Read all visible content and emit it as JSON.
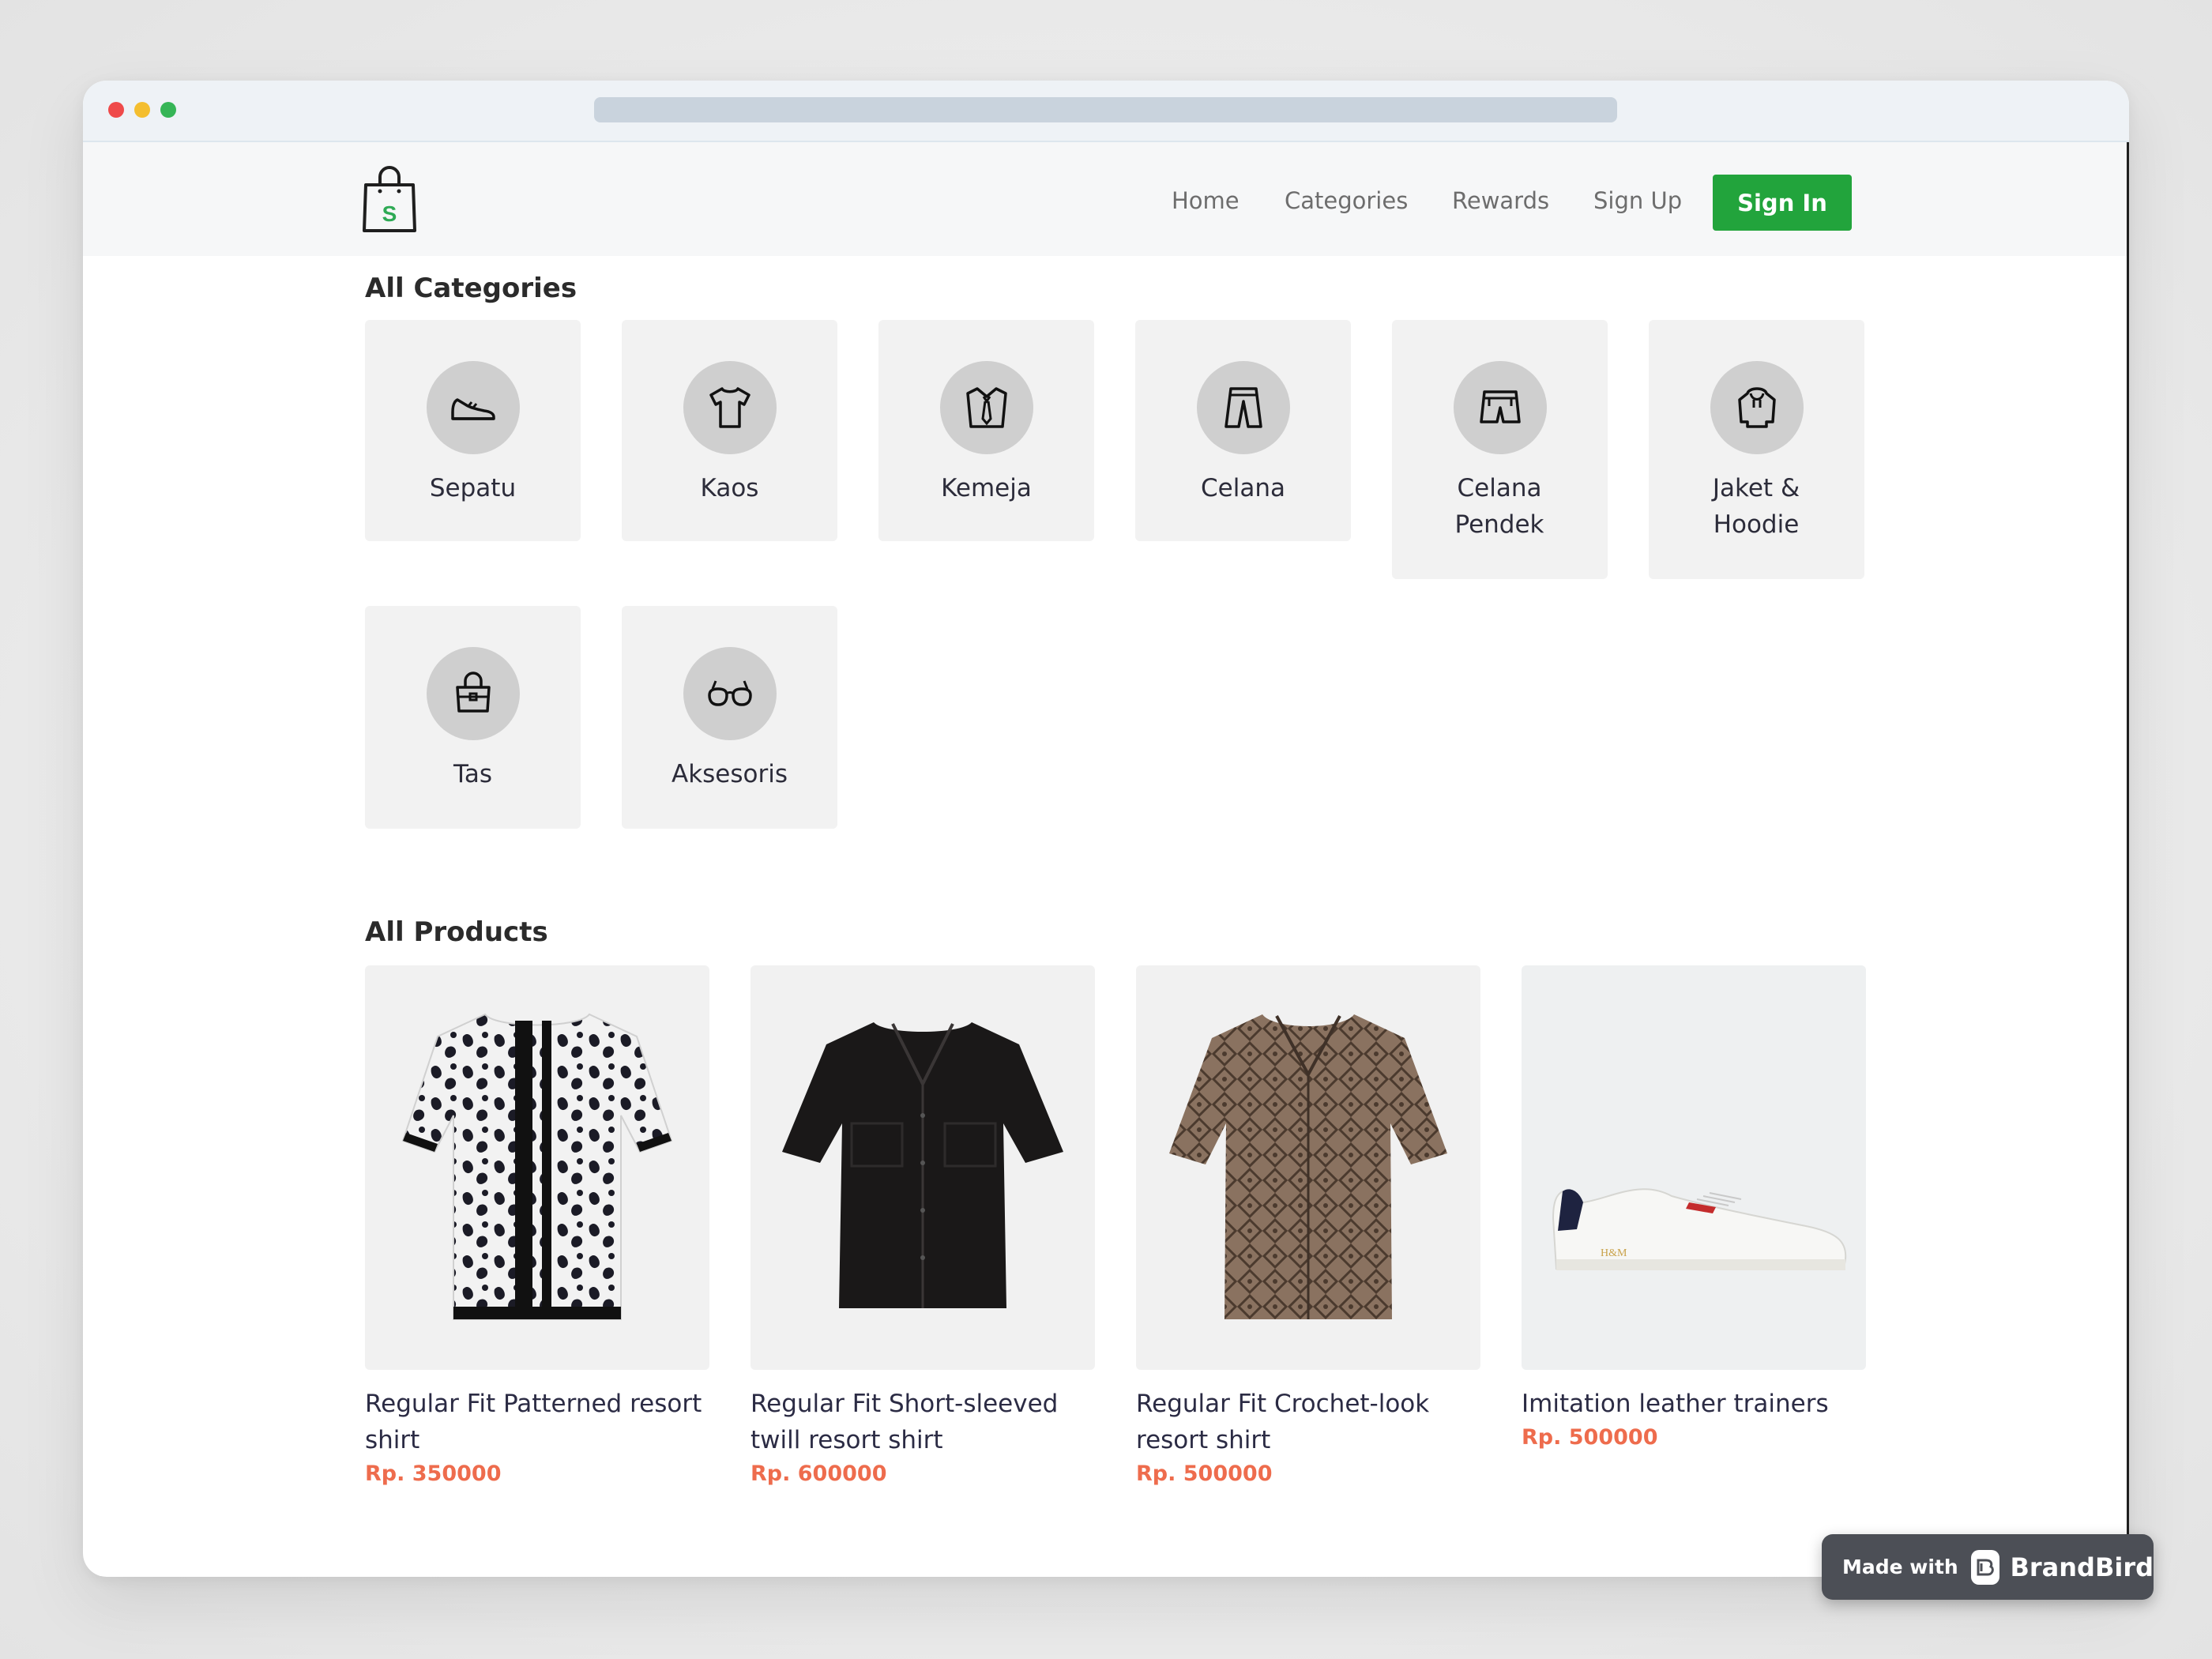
{
  "nav": {
    "logo_letter": "S",
    "links": [
      "Home",
      "Categories",
      "Rewards",
      "Sign Up"
    ],
    "signin_label": "Sign In"
  },
  "categories": {
    "title": "All Categories",
    "items": [
      {
        "label": "Sepatu",
        "icon": "shoe-icon"
      },
      {
        "label": "Kaos",
        "icon": "tshirt-icon"
      },
      {
        "label": "Kemeja",
        "icon": "shirt-tie-icon"
      },
      {
        "label": "Celana",
        "icon": "pants-icon"
      },
      {
        "label": "Celana Pendek",
        "icon": "shorts-icon"
      },
      {
        "label": "Jaket & Hoodie",
        "icon": "hoodie-icon"
      },
      {
        "label": "Tas",
        "icon": "bag-icon"
      },
      {
        "label": "Aksesoris",
        "icon": "glasses-icon"
      }
    ]
  },
  "products": {
    "title": "All Products",
    "items": [
      {
        "name": "Regular Fit Patterned resort shirt",
        "price": "Rp. 350000"
      },
      {
        "name": "Regular Fit Short-sleeved twill resort shirt",
        "price": "Rp. 600000"
      },
      {
        "name": "Regular Fit Crochet-look resort shirt",
        "price": "Rp. 500000"
      },
      {
        "name": "Imitation leather trainers",
        "price": "Rp. 500000"
      }
    ]
  },
  "badge": {
    "made_with": "Made with",
    "brand": "BrandBird"
  },
  "colors": {
    "accent": "#22a43c",
    "price": "#ee6c4d"
  }
}
